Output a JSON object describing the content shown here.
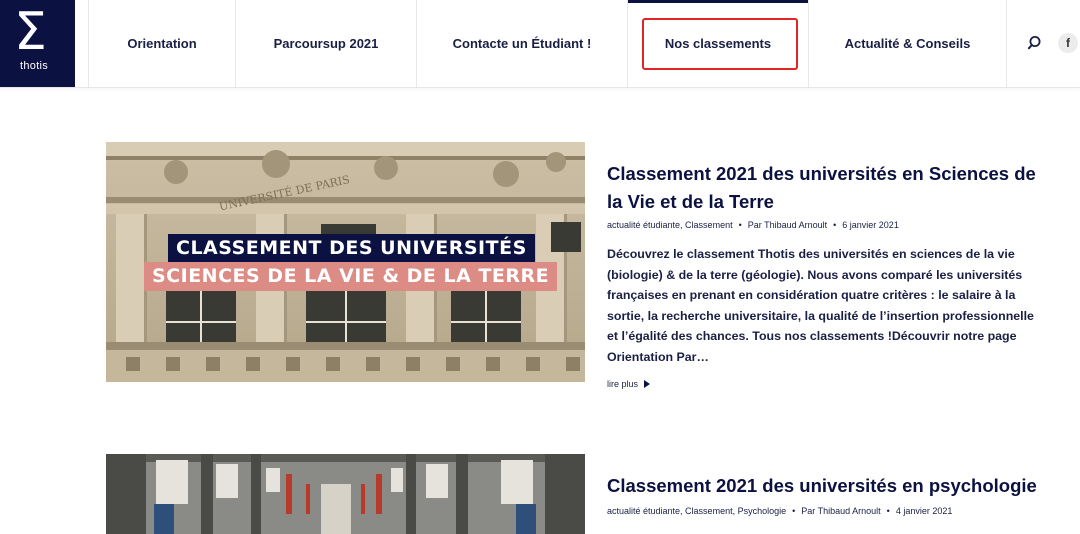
{
  "logo": {
    "symbol": "Σ",
    "name": "thotis"
  },
  "nav": {
    "items": [
      {
        "label": "Orientation"
      },
      {
        "label": "Parcoursup 2021"
      },
      {
        "label": "Contacte un Étudiant !"
      },
      {
        "label": "Nos classements"
      },
      {
        "label": "Actualité & Conseils"
      }
    ],
    "active_item": "Nos classements",
    "facebook_label": "f"
  },
  "articles": [
    {
      "image_banner_line1": "CLASSEMENT DES UNIVERSITÉS",
      "image_banner_line2": "SCIENCES DE LA VIE & DE LA TERRE",
      "title": "Classement 2021 des universités en Sciences de la Vie et de la Terre",
      "categories": "actualité étudiante, Classement",
      "author": "Par Thibaud Arnoult",
      "date": "6 janvier 2021",
      "excerpt": "Découvrez le classement Thotis des universités en sciences de la vie (biologie) & de la terre (géologie). Nous avons comparé les universités françaises en prenant en considération quatre critères : le salaire à la sortie, la recherche universitaire, la qualité de l’insertion professionnelle et l’égalité des chances. Tous nos classements !Découvrir notre page Orientation Par…",
      "read_more": "lire plus"
    },
    {
      "title": "Classement 2021 des universités en psychologie",
      "categories": "actualité étudiante, Classement, Psychologie",
      "author": "Par Thibaud Arnoult",
      "date": "4 janvier 2021"
    }
  ],
  "colors": {
    "brand_navy": "#0b1140",
    "banner_pink": "#dc8c84",
    "highlight_red": "#e02626"
  }
}
